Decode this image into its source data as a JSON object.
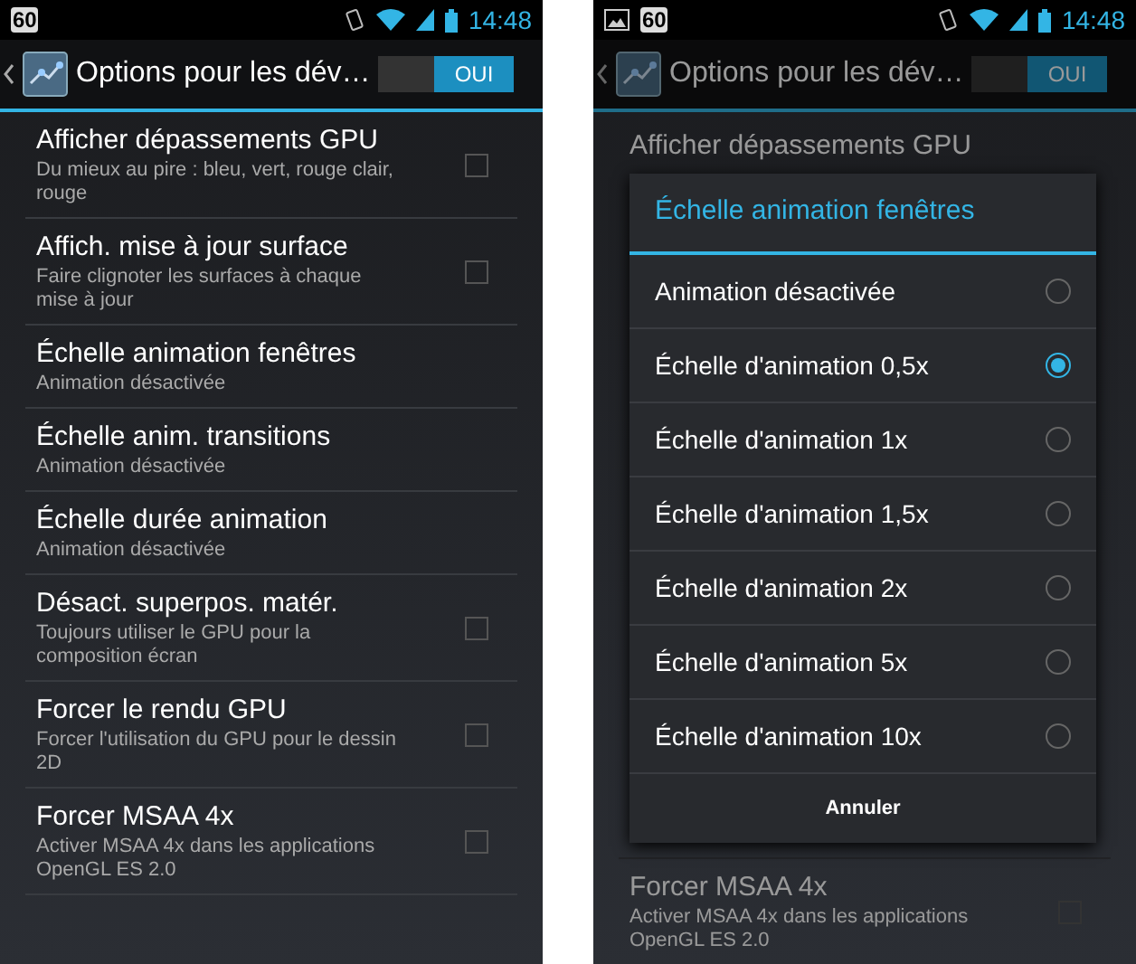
{
  "screens": [
    {
      "status_bar": {
        "notification_icons": [
          {
            "kind": "badge",
            "text": "60"
          }
        ],
        "time": "14:48"
      },
      "action_bar": {
        "title": "Options pour les dév…",
        "switch": {
          "label": "OUI",
          "on": true
        }
      },
      "settings": [
        {
          "title": "Afficher dépassements GPU",
          "summary": "Du mieux au pire : bleu, vert, rouge clair, rouge",
          "kind": "checkbox",
          "checked": false
        },
        {
          "title": "Affich. mise à jour surface",
          "summary": "Faire clignoter les surfaces à chaque mise à jour",
          "kind": "checkbox",
          "checked": false
        },
        {
          "title": "Échelle animation fenêtres",
          "summary": "Animation désactivée",
          "kind": "value"
        },
        {
          "title": "Échelle anim. transitions",
          "summary": "Animation désactivée",
          "kind": "value"
        },
        {
          "title": "Échelle durée animation",
          "summary": "Animation désactivée",
          "kind": "value"
        },
        {
          "title": "Désact. superpos. matér.",
          "summary": "Toujours utiliser le GPU pour la composition écran",
          "kind": "checkbox",
          "checked": false
        },
        {
          "title": "Forcer le rendu GPU",
          "summary": "Forcer l'utilisation du GPU pour le dessin 2D",
          "kind": "checkbox",
          "checked": false
        },
        {
          "title": "Forcer MSAA 4x",
          "summary": "Activer MSAA 4x dans les applications OpenGL ES 2.0",
          "kind": "checkbox",
          "checked": false
        }
      ]
    },
    {
      "status_bar": {
        "notification_icons": [
          {
            "kind": "image"
          },
          {
            "kind": "badge",
            "text": "60"
          }
        ],
        "time": "14:48"
      },
      "action_bar": {
        "title": "Options pour les dév…",
        "switch": {
          "label": "OUI",
          "on": true
        }
      },
      "settings": [
        {
          "title": "Afficher dépassements GPU",
          "kind": "value"
        },
        {
          "title": "Forcer MSAA 4x",
          "summary": "Activer MSAA 4x dans les applications OpenGL ES 2.0",
          "kind": "checkbox",
          "checked": false
        }
      ],
      "dialog": {
        "title": "Échelle animation fenêtres",
        "options": [
          {
            "label": "Animation désactivée",
            "selected": false
          },
          {
            "label": "Échelle d'animation 0,5x",
            "selected": true
          },
          {
            "label": "Échelle d'animation 1x",
            "selected": false
          },
          {
            "label": "Échelle d'animation 1,5x",
            "selected": false
          },
          {
            "label": "Échelle d'animation 2x",
            "selected": false
          },
          {
            "label": "Échelle d'animation 5x",
            "selected": false
          },
          {
            "label": "Échelle d'animation 10x",
            "selected": false
          }
        ],
        "button": "Annuler"
      }
    }
  ]
}
